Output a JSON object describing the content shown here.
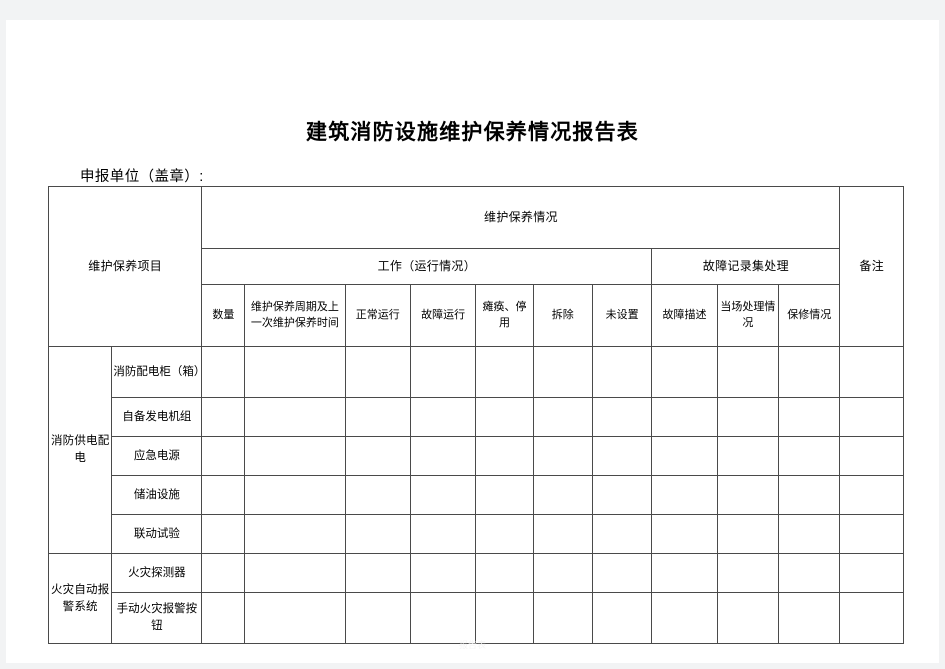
{
  "document": {
    "title": "建筑消防设施维护保养情况报告表",
    "declaring_unit_label": "申报单位（盖章）:",
    "watermark": "报告表"
  },
  "table": {
    "header": {
      "project_column": "维护保养项目",
      "maintenance_group": "维护保养情况",
      "work_group": "工作（运行情况）",
      "fault_group": "故障记录集处理",
      "remark_column": "备注",
      "columns": [
        "数量",
        "维护保养周期及上一次维护保养时间",
        "正常运行",
        "故障运行",
        "瘫痪、停用",
        "拆除",
        "未设置",
        "故障描述",
        "当场处理情况",
        "保修情况"
      ]
    },
    "groups": [
      {
        "name": "消防供电配电",
        "items": [
          "消防配电柜（箱）",
          "自备发电机组",
          "应急电源",
          "储油设施",
          "联动试验"
        ]
      },
      {
        "name": "火灾自动报警系统",
        "items": [
          "火灾探测器",
          "手动火灾报警按钮"
        ]
      }
    ]
  },
  "colors": {
    "page_background": "#f2f3f4",
    "sheet": "#ffffff",
    "border": "#4a4a4a",
    "text": "#000000"
  }
}
